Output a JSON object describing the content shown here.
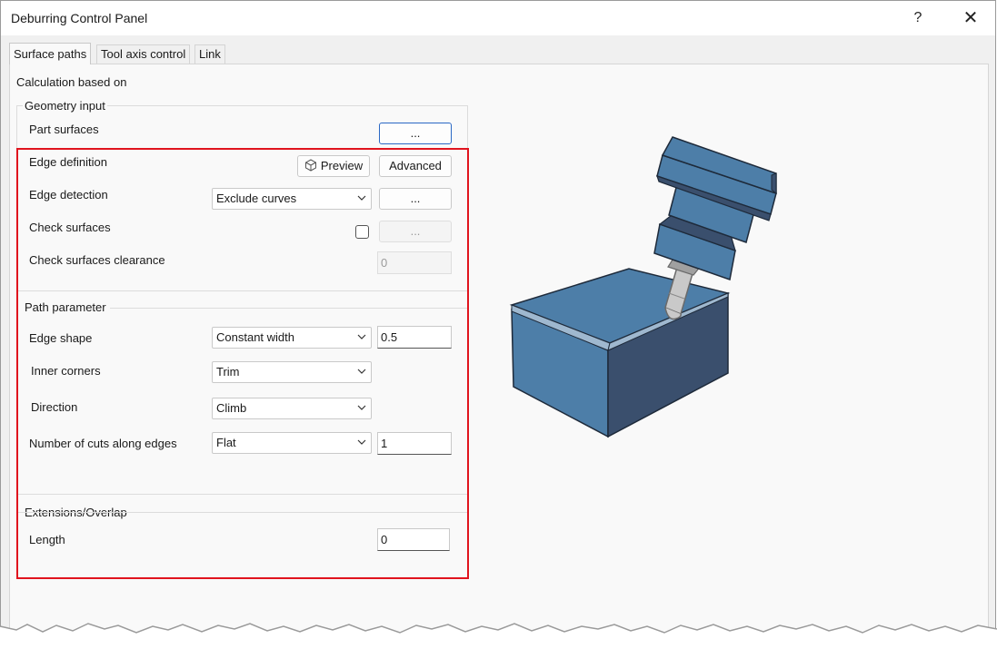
{
  "window": {
    "title": "Deburring Control Panel",
    "help_label": "?",
    "close_label": "✕"
  },
  "tabs": [
    {
      "label": "Surface paths",
      "active": true
    },
    {
      "label": "Tool axis control",
      "active": false
    },
    {
      "label": "Link",
      "active": false
    }
  ],
  "panel": {
    "calc_label": "Calculation based on",
    "geometry_input": {
      "group_label": "Geometry input",
      "part_surfaces_label": "Part surfaces",
      "part_surfaces_button": "..."
    },
    "edge": {
      "definition_label": "Edge definition",
      "preview_button": "Preview",
      "advanced_button": "Advanced",
      "detection_label": "Edge detection",
      "detection_value": "Exclude curves",
      "detection_button": "...",
      "check_surfaces_label": "Check surfaces",
      "check_surfaces_checked": false,
      "check_surfaces_button": "...",
      "clearance_label": "Check surfaces clearance",
      "clearance_value": "0"
    },
    "path_parameter": {
      "group_label": "Path parameter",
      "edge_shape_label": "Edge shape",
      "edge_shape_value": "Constant width",
      "edge_shape_width": "0.5",
      "inner_corners_label": "Inner corners",
      "inner_corners_value": "Trim",
      "direction_label": "Direction",
      "direction_value": "Climb",
      "cuts_label": "Number of cuts along edges",
      "cuts_mode_value": "Flat",
      "cuts_count": "1"
    },
    "extensions": {
      "group_label": "Extensions/Overlap",
      "length_label": "Length",
      "length_value": "0"
    }
  },
  "colors": {
    "highlight": "#e0141e",
    "focus_border": "#2a68c5",
    "part_face_light": "#4d7ea8",
    "part_face_dark": "#3a4f6d",
    "part_chamfer": "#9fb8cf"
  },
  "icons": [
    "cube-preview-icon",
    "chevron-down-icon",
    "help-icon",
    "close-icon"
  ]
}
